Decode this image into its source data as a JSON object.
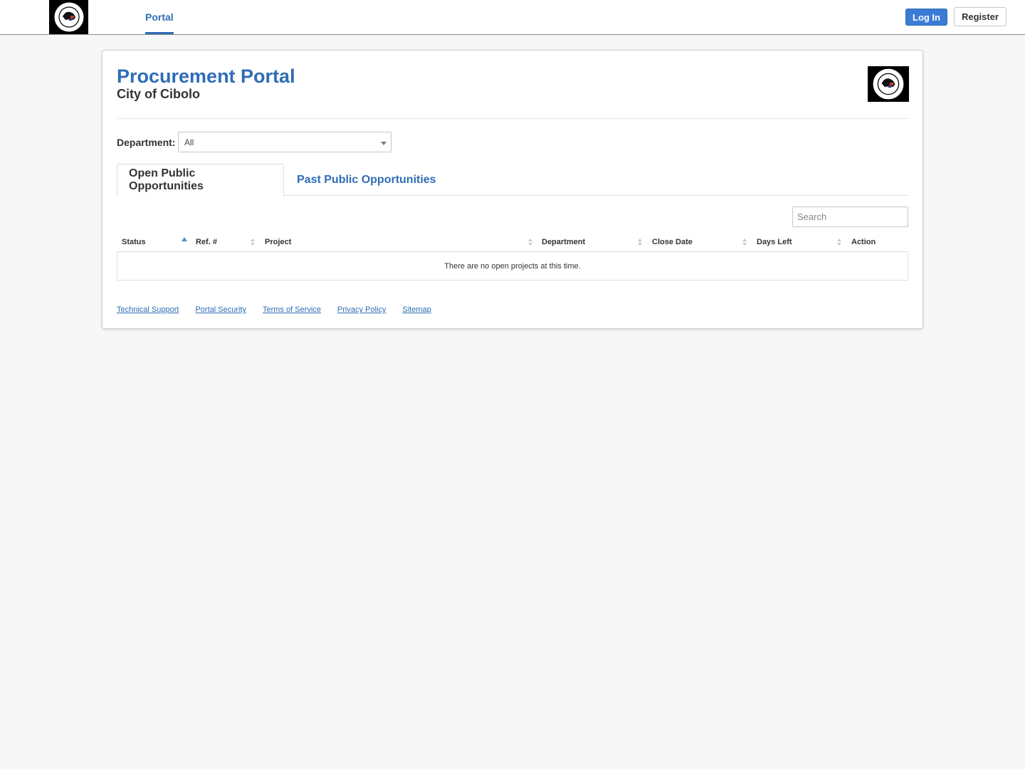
{
  "nav": {
    "tab_label": "Portal",
    "login_label": "Log In",
    "register_label": "Register"
  },
  "header": {
    "title": "Procurement Portal",
    "subtitle": "City of Cibolo"
  },
  "filter": {
    "department_label": "Department:",
    "department_value": "All"
  },
  "tabs": [
    {
      "label": "Open Public Opportunities",
      "active": true
    },
    {
      "label": "Past Public Opportunities",
      "active": false
    }
  ],
  "search": {
    "placeholder": "Search"
  },
  "table": {
    "columns": [
      "Status",
      "Ref. #",
      "Project",
      "Department",
      "Close Date",
      "Days Left",
      "Action"
    ],
    "empty_message": "There are no open projects at this time."
  },
  "footer": {
    "links": [
      "Technical Support",
      "Portal Security",
      "Terms of Service",
      "Privacy Policy",
      "Sitemap"
    ]
  },
  "colors": {
    "brand": "#2f6db5",
    "page_bg": "#f7f7f7"
  }
}
